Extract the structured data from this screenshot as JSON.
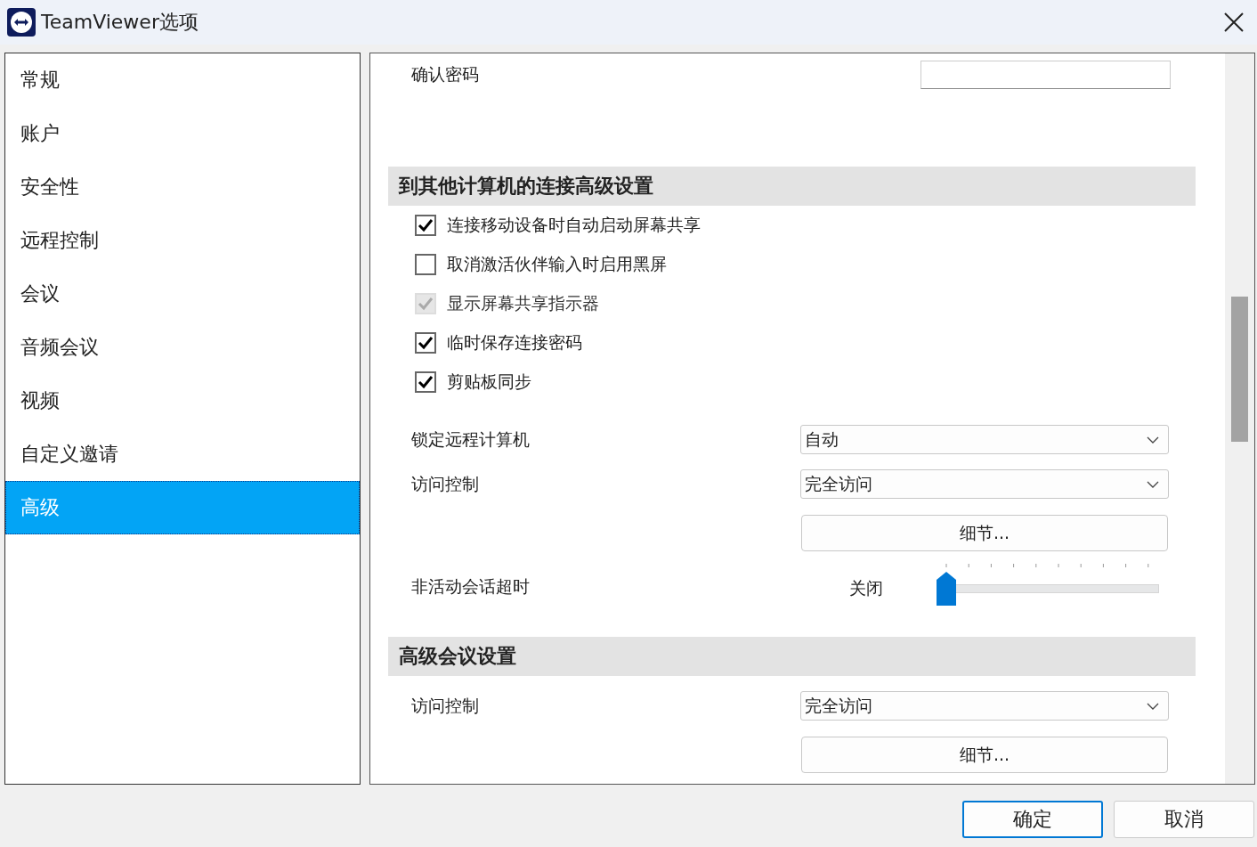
{
  "window": {
    "title": "TeamViewer选项"
  },
  "sidebar": {
    "items": [
      {
        "label": "常规",
        "selected": false
      },
      {
        "label": "账户",
        "selected": false
      },
      {
        "label": "安全性",
        "selected": false
      },
      {
        "label": "远程控制",
        "selected": false
      },
      {
        "label": "会议",
        "selected": false
      },
      {
        "label": "音频会议",
        "selected": false
      },
      {
        "label": "视频",
        "selected": false
      },
      {
        "label": "自定义邀请",
        "selected": false
      },
      {
        "label": "高级",
        "selected": true
      }
    ]
  },
  "content": {
    "rows": [
      {
        "kind": "password",
        "label": "确认密码"
      },
      {
        "kind": "header",
        "label": "到其他计算机的连接高级设置"
      },
      {
        "kind": "checkbox",
        "label": "连接移动设备时自动启动屏幕共享",
        "checked": true,
        "disabled": false
      },
      {
        "kind": "checkbox",
        "label": "取消激活伙伴输入时启用黑屏",
        "checked": false,
        "disabled": false
      },
      {
        "kind": "checkbox",
        "label": "显示屏幕共享指示器",
        "checked": true,
        "disabled": true
      },
      {
        "kind": "checkbox",
        "label": "临时保存连接密码",
        "checked": true,
        "disabled": false
      },
      {
        "kind": "checkbox",
        "label": "剪贴板同步",
        "checked": true,
        "disabled": false
      },
      {
        "kind": "select",
        "label": "锁定远程计算机",
        "value": "自动"
      },
      {
        "kind": "select",
        "label": "访问控制",
        "value": "完全访问"
      },
      {
        "kind": "button",
        "label": "细节..."
      },
      {
        "kind": "slider",
        "label": "非活动会话超时",
        "reading": "关闭",
        "level": 0
      },
      {
        "kind": "header",
        "label": "高级会议设置"
      },
      {
        "kind": "select",
        "label": "访问控制",
        "value": "完全访问"
      },
      {
        "kind": "button",
        "label": "细节..."
      }
    ]
  },
  "buttons": [
    {
      "label": "确定",
      "default": true
    },
    {
      "label": "取消",
      "default": false
    }
  ]
}
